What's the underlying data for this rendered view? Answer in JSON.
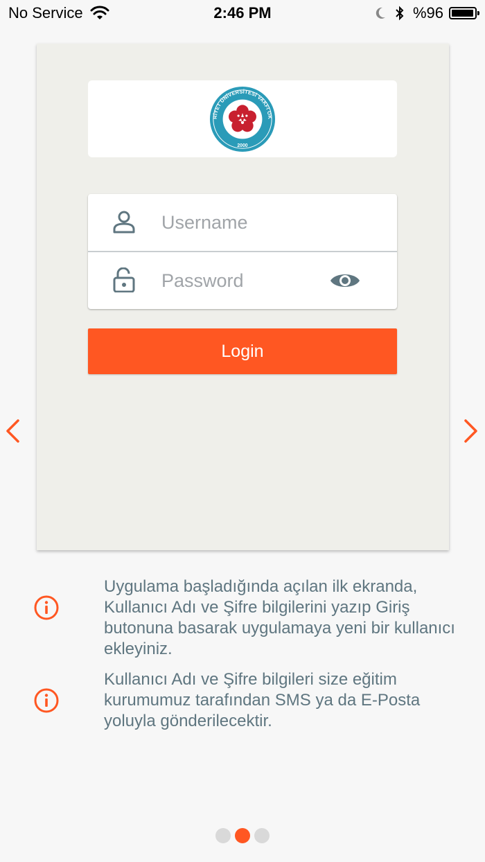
{
  "status_bar": {
    "carrier": "No Service",
    "time": "2:46 PM",
    "battery_text": "%96",
    "battery_level": 0.96,
    "icons": [
      "wifi-icon",
      "moon-icon",
      "bluetooth-icon",
      "battery-icon"
    ]
  },
  "logo": {
    "arc_text": "CUMHURİYET ÜNİVERSİTESİ VAKFI OKULLARI",
    "year": "2000"
  },
  "form": {
    "username_placeholder": "Username",
    "username_value": "",
    "password_placeholder": "Password",
    "password_value": "",
    "login_label": "Login"
  },
  "info": [
    "Uygulama başladığında açılan ilk ekranda, Kullanıcı Adı ve Şifre bilgilerini yazıp Giriş butonuna basarak uygulamaya yeni bir kullanıcı ekleyiniz.",
    "Kullanıcı Adı ve Şifre bilgileri size eğitim kurumumuz tarafından SMS ya da E-Posta yoluyla gönderilecektir."
  ],
  "pager": {
    "count": 3,
    "active_index": 1
  },
  "colors": {
    "accent": "#ff5722",
    "card_bg": "#efefea",
    "icon_gray": "#5f7680",
    "logo_teal": "#2a9bb8",
    "logo_red": "#c8202f"
  }
}
